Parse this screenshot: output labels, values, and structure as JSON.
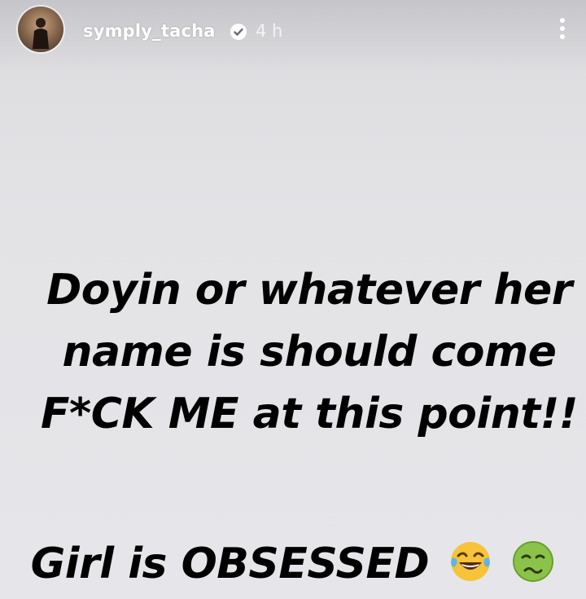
{
  "header": {
    "username": "symply_tacha",
    "time": "4 h",
    "verified": true
  },
  "icons": {
    "verified": "verified-badge-icon",
    "more": "more-vertical-icon",
    "emoji_1": "face-with-tears-of-joy-emoji",
    "emoji_2": "nauseated-face-emoji"
  },
  "story": {
    "line1": "Doyin or whatever her",
    "line2": "name is should come",
    "line3": "F*CK ME at this point!!",
    "line4": "Girl is OBSESSED"
  },
  "colors": {
    "background": "#e5e5e8",
    "text": "#000000",
    "header_text": "#ffffff"
  }
}
